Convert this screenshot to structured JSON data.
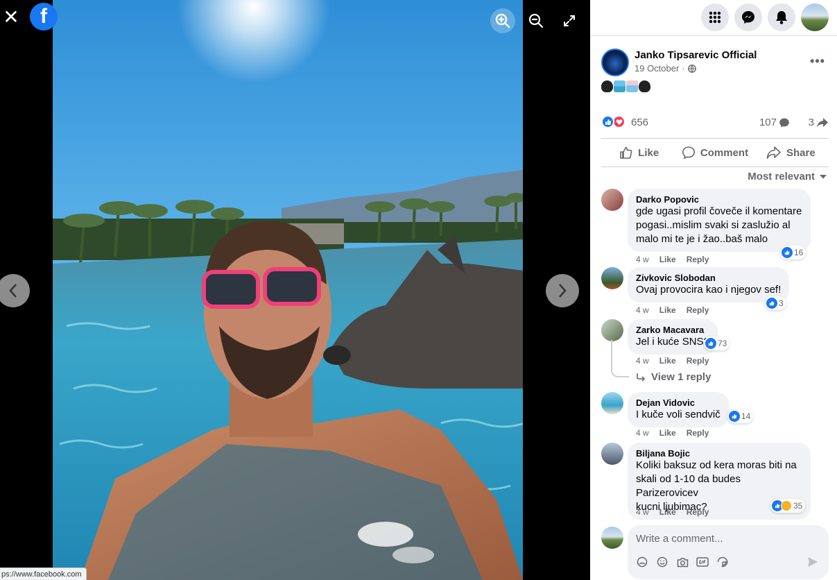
{
  "viewer": {
    "close_glyph": "✕",
    "logo_glyph": "f",
    "status_url": "ps://www.facebook.com"
  },
  "post": {
    "page_name": "Janko Tipsarevic Official",
    "date": "19 October",
    "date_separator": "·",
    "reactions_count": "656",
    "comments_count": "107",
    "shares_count": "3",
    "like_label": "Like",
    "comment_label": "Comment",
    "share_label": "Share",
    "sort_label": "Most relevant"
  },
  "comments": [
    {
      "name": "Darko Popovic",
      "text": "gde ugasi profil čoveče il komentare\npogasi..mislim svaki si zaslužio al\nmalo mi te je i žao..baš malo",
      "reacts": "16",
      "time": "4 w",
      "like": "Like",
      "reply": "Reply"
    },
    {
      "name": "Zivkovic Slobodan",
      "text": "Ovaj provocira kao i njegov sef!",
      "reacts": "3",
      "time": "4 w",
      "like": "Like",
      "reply": "Reply"
    },
    {
      "name": "Zarko Macavara",
      "text": "Jel i kuće SNS?",
      "reacts": "73",
      "time": "4 w",
      "like": "Like",
      "reply": "Reply"
    },
    {
      "name": "Dejan Vidovic",
      "text": "I kuče voli sendvič",
      "reacts": "14",
      "time": "4 w",
      "like": "Like",
      "reply": "Reply"
    },
    {
      "name": "Biljana Bojic",
      "text": "Koliki baksuz od kera moras biti na\nskali od 1-10 da budes Parizerovicev\nkucni ljubimac?",
      "reacts": "35",
      "time": "4 w",
      "like": "Like",
      "reply": "Reply"
    }
  ],
  "view_reply_label": "View 1 reply",
  "write_comment": {
    "placeholder": "Write a comment..."
  },
  "colors": {
    "brand": "#1877f2",
    "love": "#f33e58",
    "text_secondary": "#65676b"
  }
}
